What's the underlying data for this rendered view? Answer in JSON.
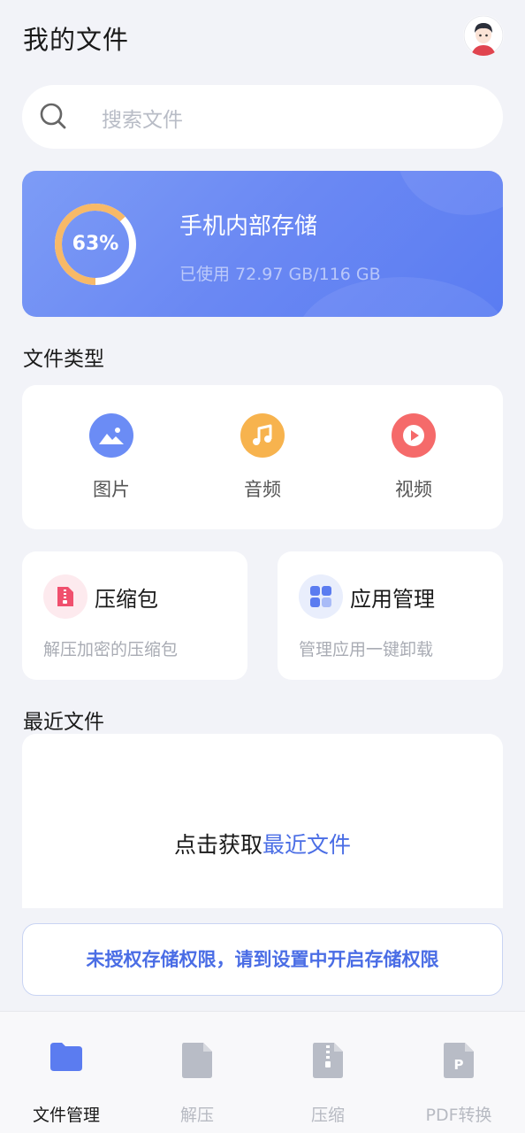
{
  "header": {
    "title": "我的文件"
  },
  "search": {
    "placeholder": "搜索文件"
  },
  "storage": {
    "percent_label": "63%",
    "used_fraction": 0.63,
    "title": "手机内部存储",
    "usage": "已使用 72.97 GB/116 GB"
  },
  "file_types": {
    "title": "文件类型",
    "items": [
      {
        "label": "图片",
        "icon": "image-icon",
        "color": "#6b8cf5"
      },
      {
        "label": "音频",
        "icon": "music-icon",
        "color": "#f7b34e"
      },
      {
        "label": "视频",
        "icon": "play-icon",
        "color": "#f56a6a"
      }
    ]
  },
  "tools": [
    {
      "title": "压缩包",
      "desc": "解压加密的压缩包",
      "icon": "archive-icon",
      "color": "#f0506e"
    },
    {
      "title": "应用管理",
      "desc": "管理应用一键卸载",
      "icon": "apps-grid-icon",
      "color": "#6b8cf5"
    }
  ],
  "recent": {
    "title": "最近文件",
    "prompt": "点击获取",
    "link": "最近文件"
  },
  "permission_notice": "未授权存储权限，请到设置中开启存储权限",
  "tabs": [
    {
      "label": "文件管理",
      "icon": "folder-icon",
      "active": true
    },
    {
      "label": "解压",
      "icon": "document-icon",
      "active": false
    },
    {
      "label": "压缩",
      "icon": "zip-file-icon",
      "active": false
    },
    {
      "label": "PDF转换",
      "icon": "pdf-file-icon",
      "active": false
    }
  ],
  "colors": {
    "accent": "#4a6de5",
    "ring": "#f7b968",
    "background": "#f2f3f8"
  }
}
